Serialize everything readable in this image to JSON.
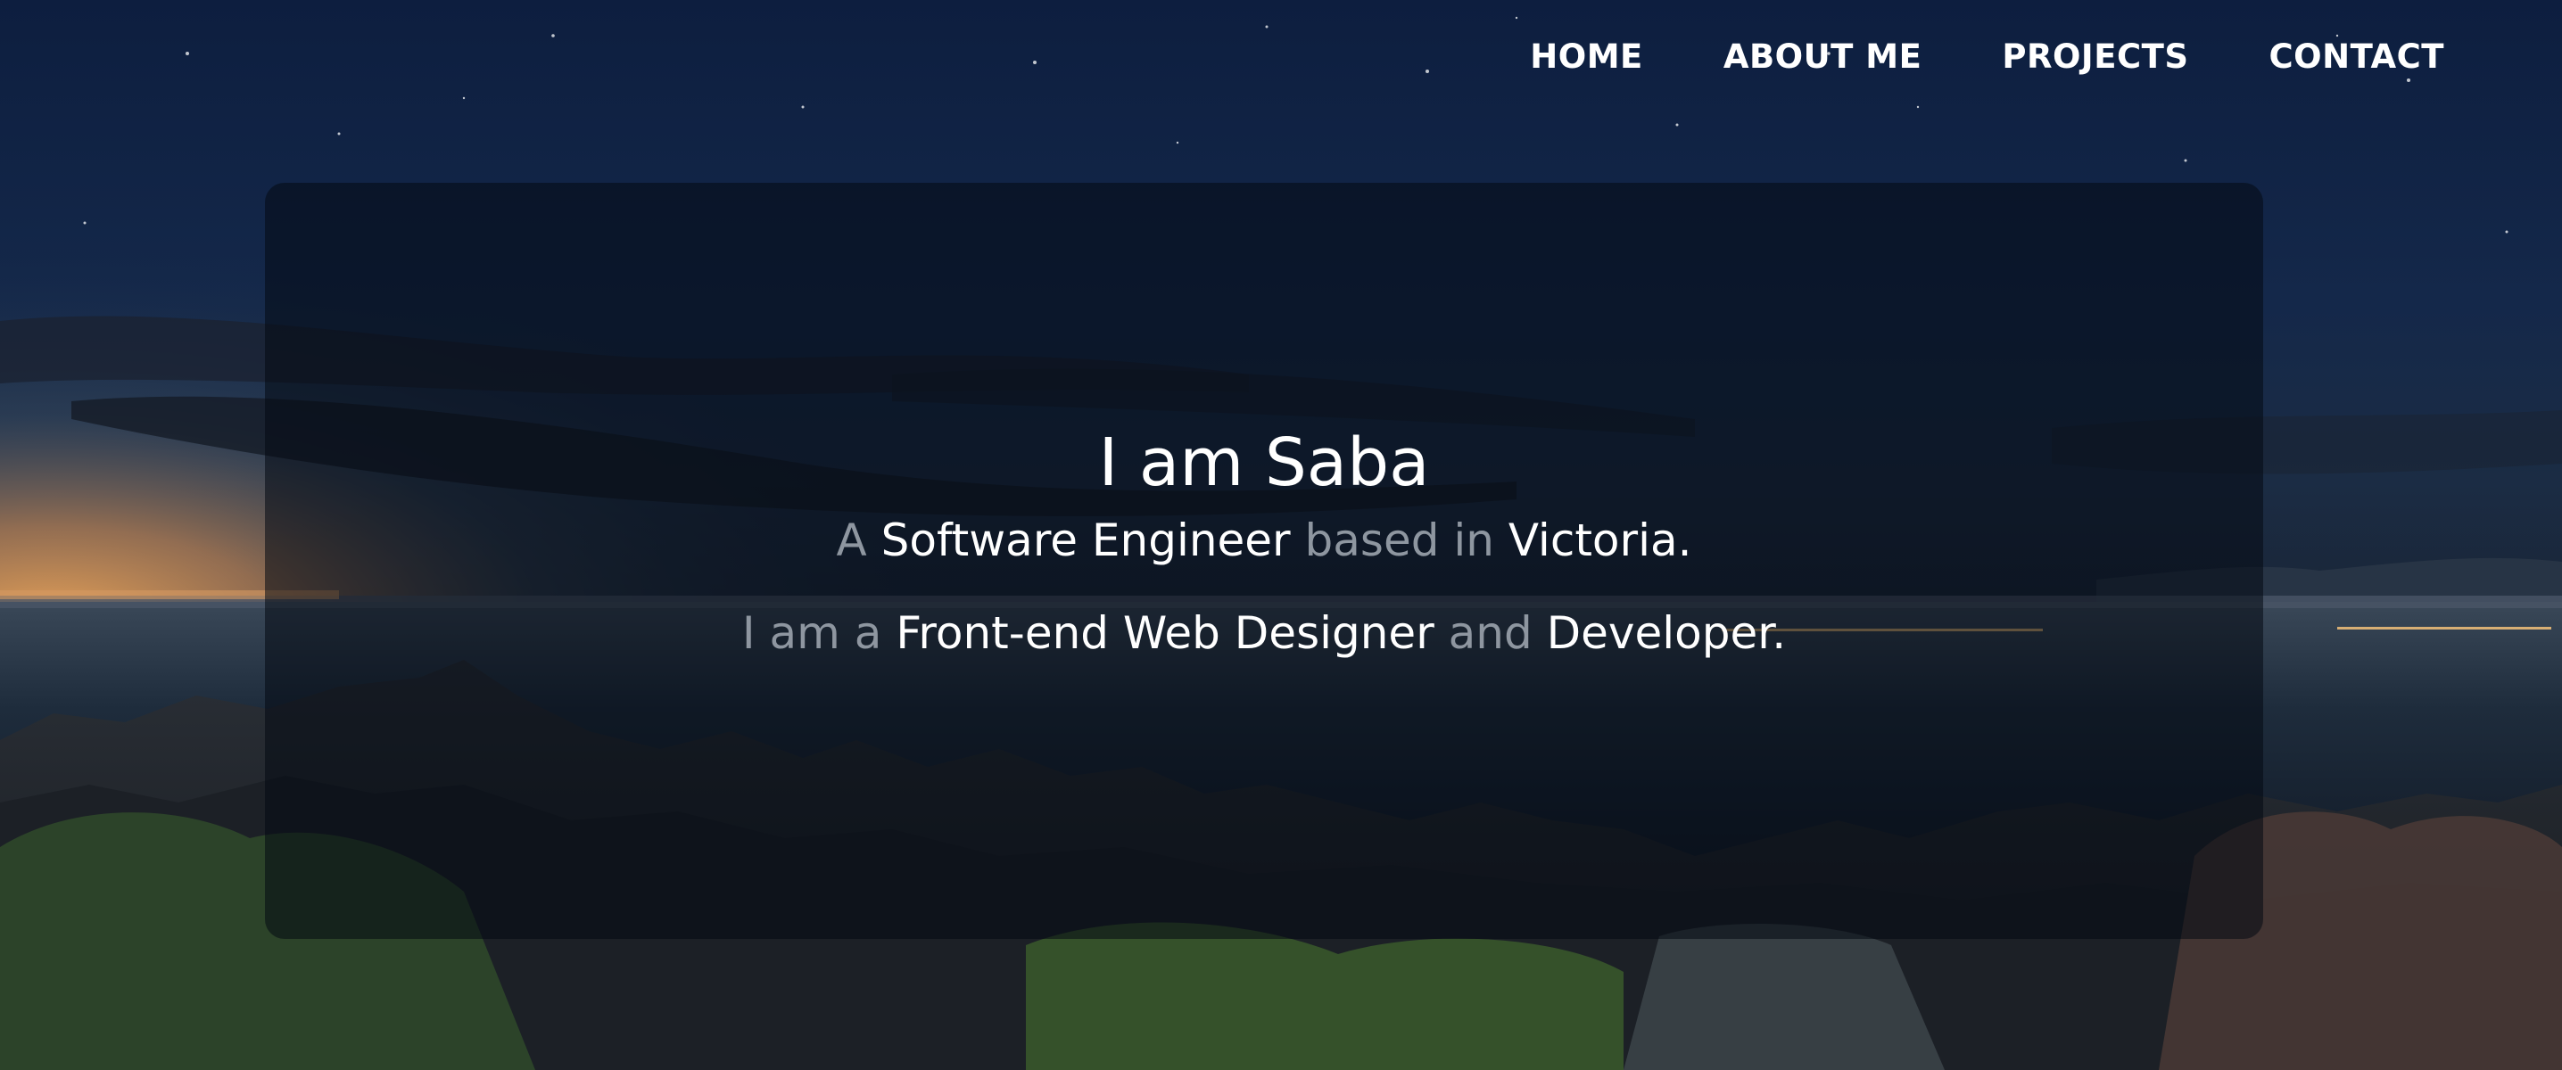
{
  "nav": {
    "items": [
      {
        "label": "HOME"
      },
      {
        "label": "ABOUT ME"
      },
      {
        "label": "PROJECTS"
      },
      {
        "label": "CONTACT"
      }
    ]
  },
  "hero": {
    "title": "I am Saba",
    "line1": {
      "a": "A",
      "role": "Software Engineer",
      "based_in": "based in",
      "city": "Victoria."
    },
    "line2": {
      "i_am_a": "I am a",
      "role": "Front-end Web Designer",
      "and": "and",
      "developer": "Developer."
    }
  },
  "colors": {
    "text_primary": "#ffffff",
    "text_muted": "#8e96a0",
    "card_overlay": "rgba(4,10,18,0.55)"
  },
  "background": {
    "icon": "night-coastline-photo"
  }
}
